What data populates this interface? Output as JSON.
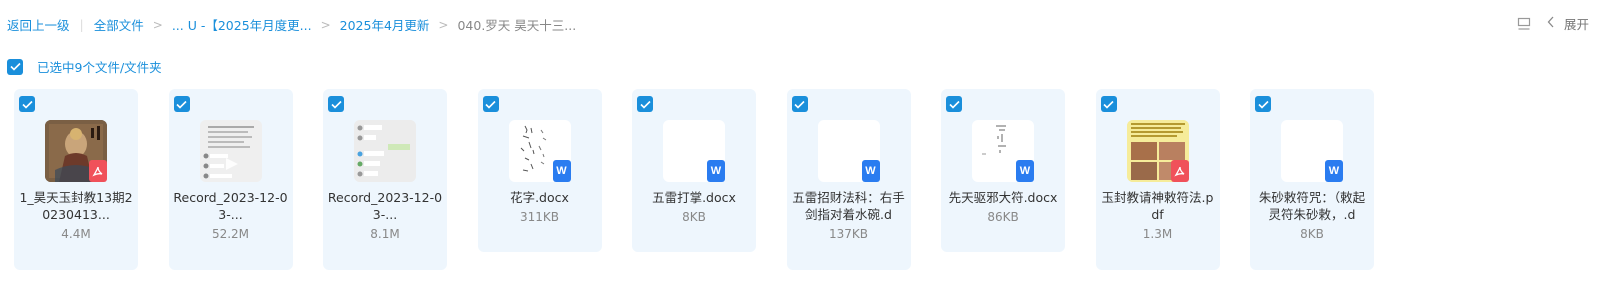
{
  "breadcrumb": {
    "back": "返回上一级",
    "items": [
      "全部文件",
      "... U -【2025年月度更...",
      "2025年4月更新",
      "040.罗天 昊天十三..."
    ]
  },
  "toolbar": {
    "expand_label": "展开"
  },
  "selection": {
    "text": "已选中9个文件/文件夹"
  },
  "files": [
    {
      "name": "1_昊天玉封教13期20230413...",
      "size": "4.4M",
      "type": "pdf"
    },
    {
      "name": "Record_2023-12-03-...",
      "size": "52.2M",
      "type": "image"
    },
    {
      "name": "Record_2023-12-03-...",
      "size": "8.1M",
      "type": "image"
    },
    {
      "name": "花字.docx",
      "size": "311KB",
      "type": "docx"
    },
    {
      "name": "五雷打掌.docx",
      "size": "8KB",
      "type": "docx"
    },
    {
      "name": "五雷招财法科：右手剑指对着水碗.d",
      "size": "137KB",
      "type": "docx"
    },
    {
      "name": "先天驱邪大符.docx",
      "size": "86KB",
      "type": "docx"
    },
    {
      "name": "玉封教请神敕符法.pdf",
      "size": "1.3M",
      "type": "pdf"
    },
    {
      "name": "朱砂敕符咒：（敕起灵符朱砂敕，.d",
      "size": "8KB",
      "type": "docx"
    }
  ],
  "colors": {
    "accent": "#1a8fdb",
    "card_bg": "#eef6fd",
    "pdf": "#f0515a",
    "doc": "#2a7cf0"
  }
}
